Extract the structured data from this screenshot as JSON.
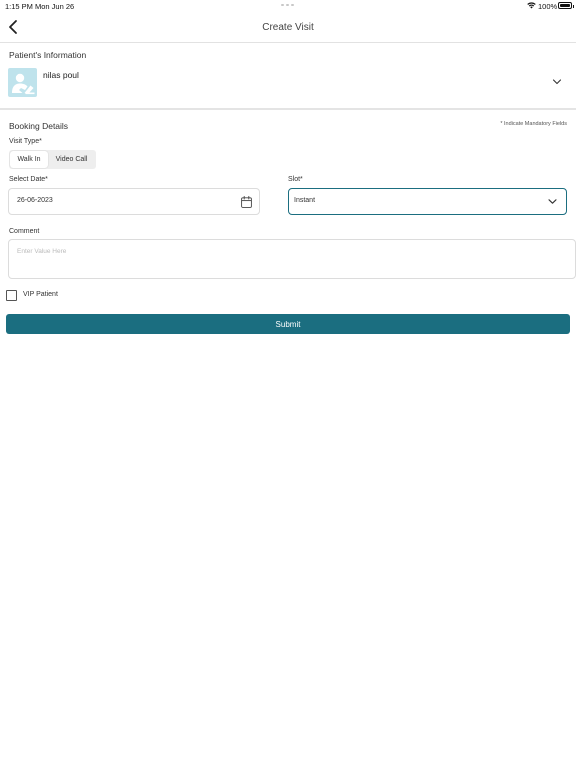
{
  "status_bar": {
    "time": "1:15 PM",
    "date": "Mon Jun 26",
    "battery": "100%"
  },
  "header": {
    "title": "Create Visit",
    "back_icon": "chevron-left-icon"
  },
  "patient_section": {
    "heading": "Patient's Information",
    "name": "nilas  poul",
    "avatar_color": "#bfe3ec"
  },
  "booking": {
    "heading": "Booking Details",
    "mandatory_note": "* Indicate Mandatory Fields",
    "visit_type_label": "Visit Type*",
    "visit_types": [
      "Walk In",
      "Video Call"
    ],
    "selected_visit_type": "Walk In",
    "date_label": "Select Date*",
    "date_value": "26-06-2023",
    "slot_label": "Slot*",
    "slot_value": "Instant",
    "comment_label": "Comment",
    "comment_placeholder": "Enter Value Here",
    "vip_label": "VIP Patient",
    "vip_checked": false,
    "submit_label": "Submit"
  },
  "colors": {
    "accent": "#1b6e80",
    "border": "#dcdcdc"
  }
}
